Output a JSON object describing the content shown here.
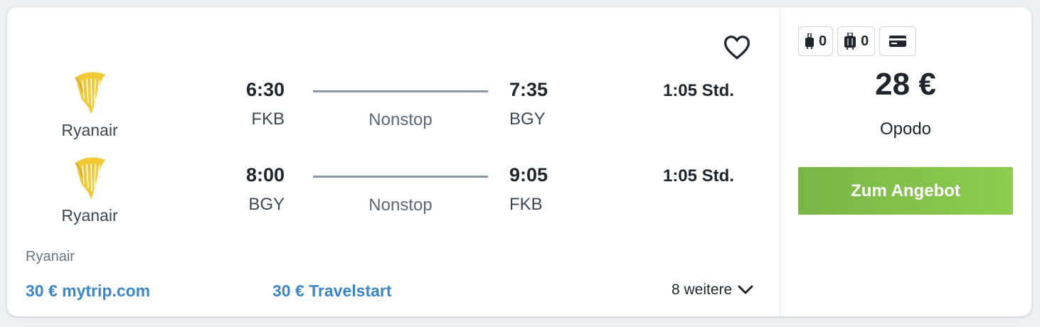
{
  "legs": [
    {
      "airline": "Ryanair",
      "dep_time": "6:30",
      "dep_code": "FKB",
      "stops": "Nonstop",
      "arr_time": "7:35",
      "arr_code": "BGY",
      "duration": "1:05 Std."
    },
    {
      "airline": "Ryanair",
      "dep_time": "8:00",
      "dep_code": "BGY",
      "stops": "Nonstop",
      "arr_time": "9:05",
      "arr_code": "FKB",
      "duration": "1:05 Std."
    }
  ],
  "operator": "Ryanair",
  "alternatives": [
    {
      "label": "30 € mytrip.com"
    },
    {
      "label": "30 € Travelstart"
    }
  ],
  "more_label": "8 weitere",
  "baggage": {
    "carry_on_count": "0",
    "checked_count": "0",
    "icons": [
      "carry-on-bag-icon",
      "checked-bag-icon",
      "credit-card-icon"
    ]
  },
  "price": "28 €",
  "provider": "Opodo",
  "cta_label": "Zum Angebot",
  "colors": {
    "accent_link": "#3a86c8",
    "cta_start": "#7ab547",
    "cta_end": "#8ccd4f",
    "logo_yellow": "#f1c933"
  }
}
